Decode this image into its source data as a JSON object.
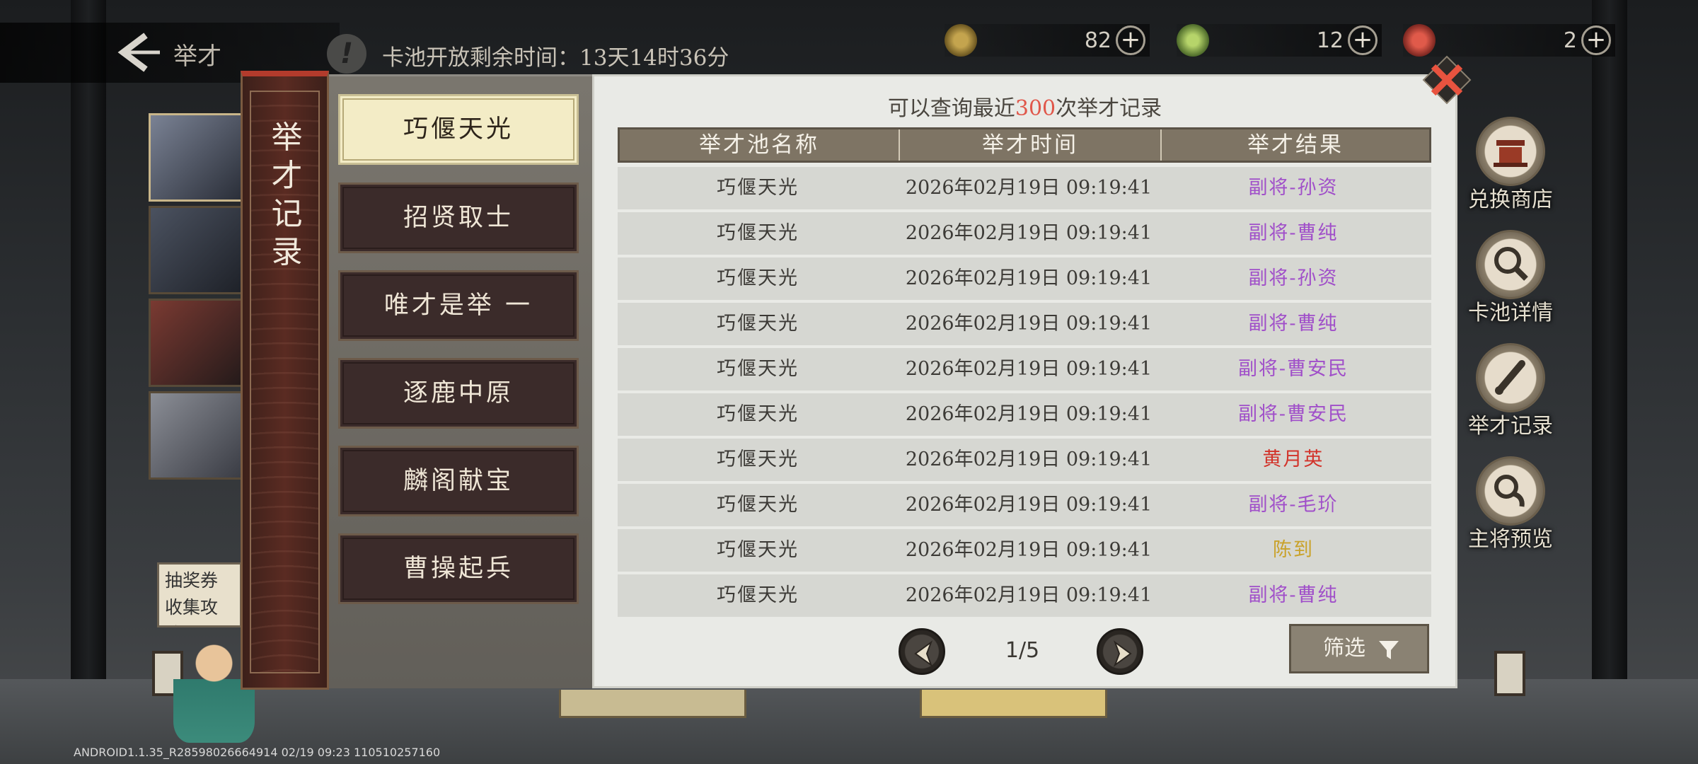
{
  "header": {
    "back_label": "举才",
    "info_icon": "!",
    "timer_text": "卡池开放剩余时间：13天14时36分"
  },
  "currencies": [
    {
      "icon": "coin-icon",
      "value": "82",
      "plus": "+"
    },
    {
      "icon": "jade-icon",
      "value": "12",
      "plus": "+"
    },
    {
      "icon": "token-icon",
      "value": "2",
      "plus": "+"
    }
  ],
  "side_menu": [
    {
      "icon": "shop-icon",
      "label": "兑换商店"
    },
    {
      "icon": "magnifier-icon",
      "label": "卡池详情"
    },
    {
      "icon": "brush-icon",
      "label": "举才记录"
    },
    {
      "icon": "preview-icon",
      "label": "主将预览"
    }
  ],
  "background": {
    "coupon_text": "抽奖券收集攻略"
  },
  "modal": {
    "strip_title": [
      "举",
      "才",
      "记",
      "录"
    ],
    "tabs": [
      {
        "label": "巧偃天光",
        "active": true
      },
      {
        "label": "招贤取士",
        "active": false
      },
      {
        "label": "唯才是举 一",
        "active": false
      },
      {
        "label": "逐鹿中原",
        "active": false
      },
      {
        "label": "麟阁献宝",
        "active": false
      },
      {
        "label": "曹操起兵",
        "active": false
      }
    ],
    "hint_prefix": "可以查询最近",
    "hint_number": "300",
    "hint_suffix": "次举才记录",
    "columns": [
      "举才池名称",
      "举才时间",
      "举才结果"
    ],
    "rows": [
      {
        "pool": "巧偃天光",
        "time": "2026年02月19日 09:19:41",
        "result": "副将-孙资",
        "color": "#a04fc9"
      },
      {
        "pool": "巧偃天光",
        "time": "2026年02月19日 09:19:41",
        "result": "副将-曹纯",
        "color": "#a04fc9"
      },
      {
        "pool": "巧偃天光",
        "time": "2026年02月19日 09:19:41",
        "result": "副将-孙资",
        "color": "#a04fc9"
      },
      {
        "pool": "巧偃天光",
        "time": "2026年02月19日 09:19:41",
        "result": "副将-曹纯",
        "color": "#a04fc9"
      },
      {
        "pool": "巧偃天光",
        "time": "2026年02月19日 09:19:41",
        "result": "副将-曹安民",
        "color": "#a04fc9"
      },
      {
        "pool": "巧偃天光",
        "time": "2026年02月19日 09:19:41",
        "result": "副将-曹安民",
        "color": "#a04fc9"
      },
      {
        "pool": "巧偃天光",
        "time": "2026年02月19日 09:19:41",
        "result": "黄月英",
        "color": "#d2332a"
      },
      {
        "pool": "巧偃天光",
        "time": "2026年02月19日 09:19:41",
        "result": "副将-毛玠",
        "color": "#a04fc9"
      },
      {
        "pool": "巧偃天光",
        "time": "2026年02月19日 09:19:41",
        "result": "陈到",
        "color": "#c9a22a"
      },
      {
        "pool": "巧偃天光",
        "time": "2026年02月19日 09:19:41",
        "result": "副将-曹纯",
        "color": "#a04fc9"
      }
    ],
    "page_indicator": "1/5",
    "filter_label": "筛选"
  },
  "footer": {
    "build_text": "ANDROID1.1.35_R28598026664914 02/19 09:23 110510257160"
  },
  "colors": {
    "accent_red": "#e0574a",
    "rare_purple": "#a04fc9",
    "legendary_red": "#d2332a",
    "gold": "#c9a22a"
  }
}
